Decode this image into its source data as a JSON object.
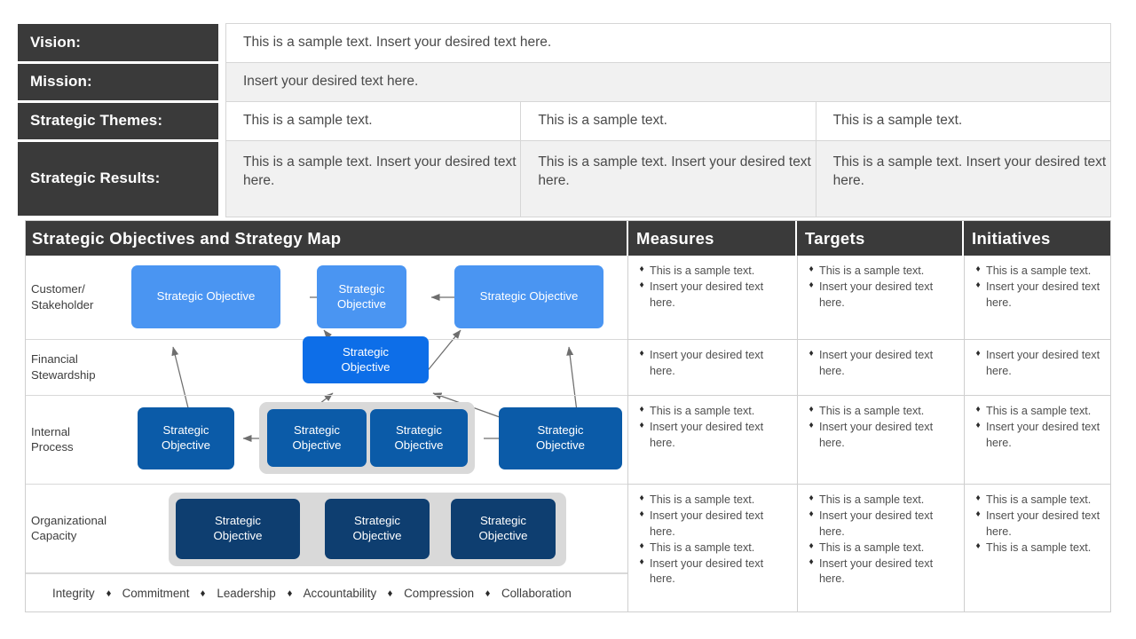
{
  "top_table": {
    "rows": [
      {
        "label": "Vision:",
        "cells": [
          "This is a sample text. Insert your desired text here."
        ]
      },
      {
        "label": "Mission:",
        "cells": [
          "Insert your desired text here."
        ]
      },
      {
        "label": "Strategic Themes:",
        "cells": [
          "This is a sample text.",
          "This is a sample text.",
          "This is a sample text."
        ]
      },
      {
        "label": "Strategic Results:",
        "cells": [
          "This is a sample text. Insert your desired text here.",
          "This is a sample text. Insert your desired text here.",
          "This is a sample text. Insert your desired text here."
        ]
      }
    ]
  },
  "panel": {
    "headers": {
      "map": "Strategic  Objectives and Strategy Map",
      "measures": "Measures",
      "targets": "Targets",
      "initiatives": "Initiatives"
    },
    "perspectives": [
      {
        "label": "Customer/\nStakeholder"
      },
      {
        "label": "Financial\nStewardship"
      },
      {
        "label": "Internal\nProcess"
      },
      {
        "label": "Organizational\nCapacity"
      }
    ],
    "objective_label": "Strategic Objective",
    "objective_label_wrapped": "Strategic\nObjective",
    "values": [
      "Integrity",
      "Commitment",
      "Leadership",
      "Accountability",
      "Compression",
      "Collaboration"
    ],
    "measures": [
      [
        "This is a sample text.",
        "Insert your desired text here."
      ],
      [
        "Insert your desired text here."
      ],
      [
        "This is a sample text.",
        "Insert your desired text here."
      ],
      [
        "This is a sample text.",
        "Insert your desired text here.",
        "This is a sample text.",
        "Insert your desired text here."
      ]
    ],
    "targets": [
      [
        "This is a sample text.",
        "Insert your desired text here."
      ],
      [
        "Insert your desired text here."
      ],
      [
        "This is a sample text.",
        "Insert your desired text here."
      ],
      [
        "This is a sample text.",
        "Insert your desired text here.",
        "This is a sample text.",
        "Insert your desired text here."
      ]
    ],
    "initiatives": [
      [
        "This is a sample text.",
        "Insert your desired text here."
      ],
      [
        "Insert your desired text here."
      ],
      [
        "This is a sample text.",
        "Insert your desired text here."
      ],
      [
        "This is a sample text.",
        "Insert your desired text here.",
        "This is a sample text."
      ]
    ]
  },
  "colors": {
    "header_dark": "#3a3a3a",
    "objective_light": "#4a95f2",
    "objective_mid": "#0d6ee8",
    "objective_deep": "#0b5ba8",
    "objective_navy": "#0e3e70",
    "group_grey": "#d9d9d9",
    "row_alt": "#f1f1f1"
  }
}
